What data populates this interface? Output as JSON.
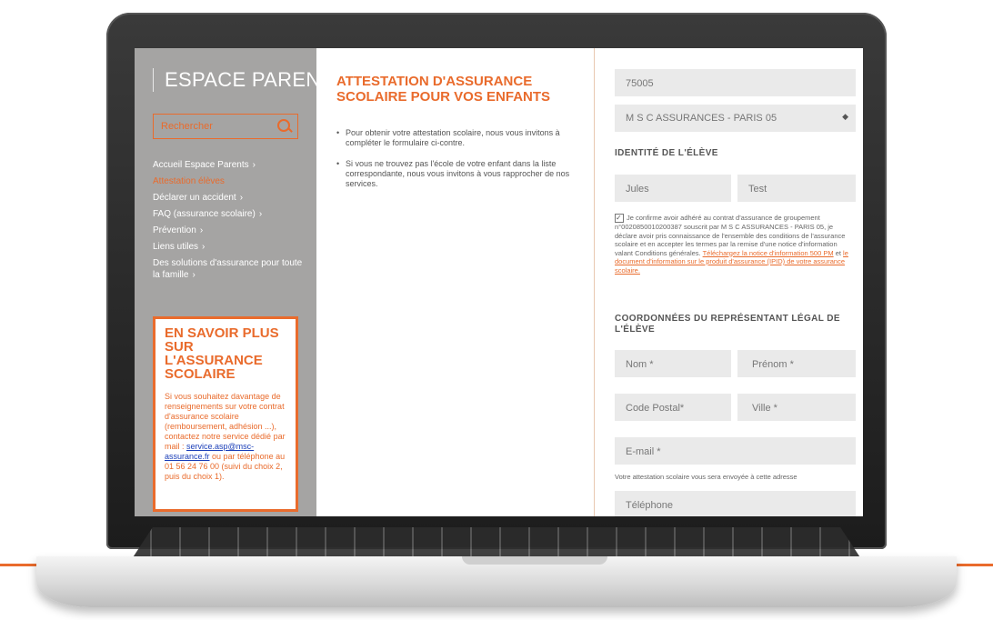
{
  "sidebar": {
    "brand": "ESPACE PARENTS",
    "search_placeholder": "Rechercher",
    "nav": [
      {
        "label": "Accueil Espace Parents",
        "chevron": "›"
      },
      {
        "label": "Attestation élèves",
        "chevron": ""
      },
      {
        "label": "Déclarer un accident",
        "chevron": "›"
      },
      {
        "label": "FAQ (assurance scolaire)",
        "chevron": "›"
      },
      {
        "label": "Prévention",
        "chevron": "›"
      },
      {
        "label": "Liens utiles",
        "chevron": "›"
      },
      {
        "label": "Des solutions d'assurance pour toute la famille",
        "chevron": "›"
      }
    ],
    "promo": {
      "title": "EN SAVOIR PLUS SUR L'ASSURANCE SCOLAIRE",
      "text_before": "Si vous souhaitez davantage de renseignements sur votre contrat d'assurance scolaire (remboursement, adhésion ...), contactez notre service dédié par mail : ",
      "email": "service.asp@msc-assurance.fr",
      "text_after": " ou par téléphone au 01 56 24 76 00 (suivi du choix 2, puis du choix 1)."
    }
  },
  "main": {
    "title": "ATTESTATION D'ASSURANCE SCOLAIRE POUR VOS ENFANTS",
    "bullets": [
      "Pour obtenir votre attestation scolaire, nous vous invitons à compléter le formulaire ci-contre.",
      "Si vous ne trouvez pas l'école de votre enfant dans la liste correspondante, nous vous invitons à vous rapprocher de nos services."
    ]
  },
  "form": {
    "postal_value": "75005",
    "agency_value": "M S C ASSURANCES - PARIS 05",
    "student_section": "IDENTITÉ DE L'ÉLÈVE",
    "student_firstname": "Jules",
    "student_lastname": "Test",
    "consent_text": "Je confirme avoir adhéré au contrat d'assurance de groupement n°00208500102003​87 souscrit par M S C ASSURANCES - PARIS 05, je déclare avoir pris connaissance de l'ensemble des conditions de l'assurance scolaire et en accepter les termes par la remise d'une notice d'information valant Conditions générales. ",
    "consent_link_1": "Téléchargez la notice d'information 500 PM",
    "consent_and": " et ",
    "consent_link_2": "le document d'information sur le produit d'assurance (IPID) de votre assurance scolaire.",
    "checkbox_mark": "✓",
    "rep_section": "COORDONNÉES DU REPRÉSENTANT LÉGAL DE L'ÉLÈVE",
    "nom_placeholder": "Nom *",
    "prenom_placeholder": "Prénom *",
    "cp_placeholder": "Code Postal*",
    "ville_placeholder": "Ville *",
    "email_placeholder": "E-mail *",
    "email_helper": "Votre attestation scolaire vous sera envoyée à cette adresse",
    "phone_placeholder": "Téléphone"
  },
  "colors": {
    "accent": "#e96b2c",
    "sidebar": "#a5a4a3",
    "field": "#eaeaea"
  }
}
